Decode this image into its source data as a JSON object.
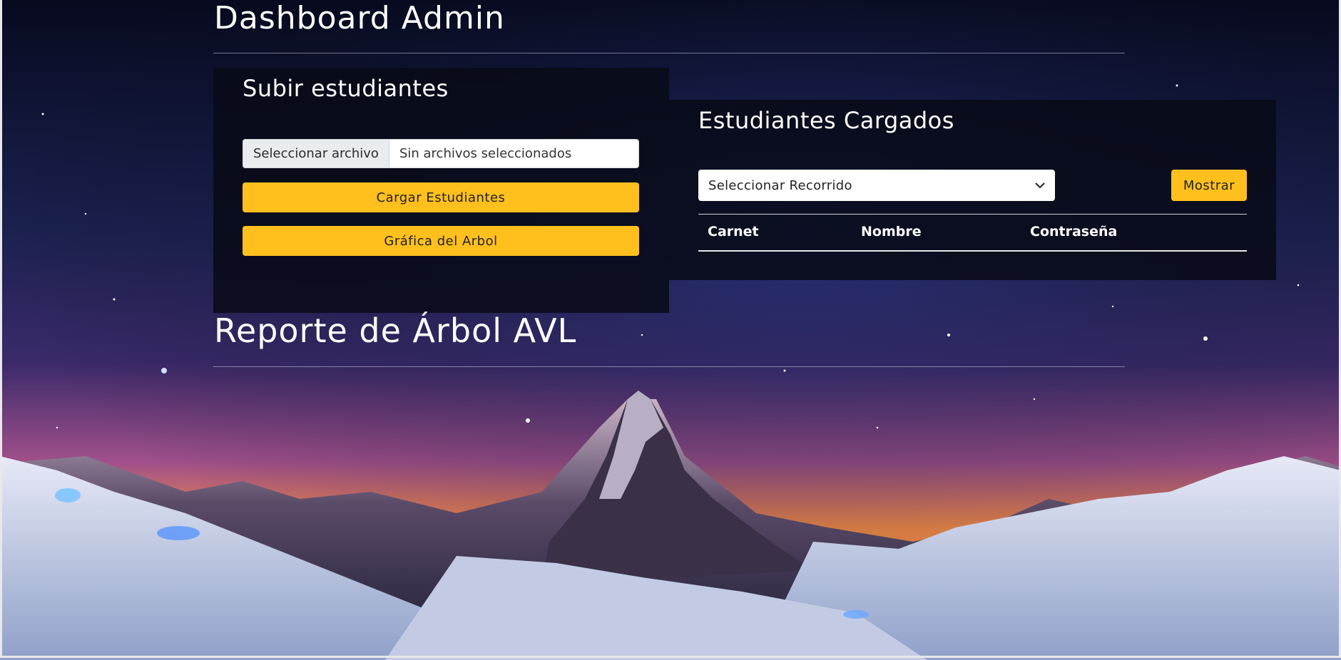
{
  "header": {
    "title": "Dashboard Admin"
  },
  "upload_panel": {
    "title": "Subir estudiantes",
    "file_button_label": "Seleccionar archivo",
    "file_status": "Sin archivos seleccionados",
    "load_button_label": "Cargar Estudiantes",
    "graph_button_label": "Gráfica del Arbol"
  },
  "students_panel": {
    "title": "Estudiantes Cargados",
    "traversal_select": {
      "selected": "Seleccionar Recorrido",
      "icon": "chevron-down-icon"
    },
    "show_button_label": "Mostrar",
    "table": {
      "columns": [
        "Carnet",
        "Nombre",
        "Contraseña"
      ],
      "rows": []
    }
  },
  "report": {
    "title": "Reporte de Árbol AVL"
  },
  "colors": {
    "accent": "#ffc01e",
    "panel_bg": "#080a16",
    "text": "#ffffff"
  }
}
